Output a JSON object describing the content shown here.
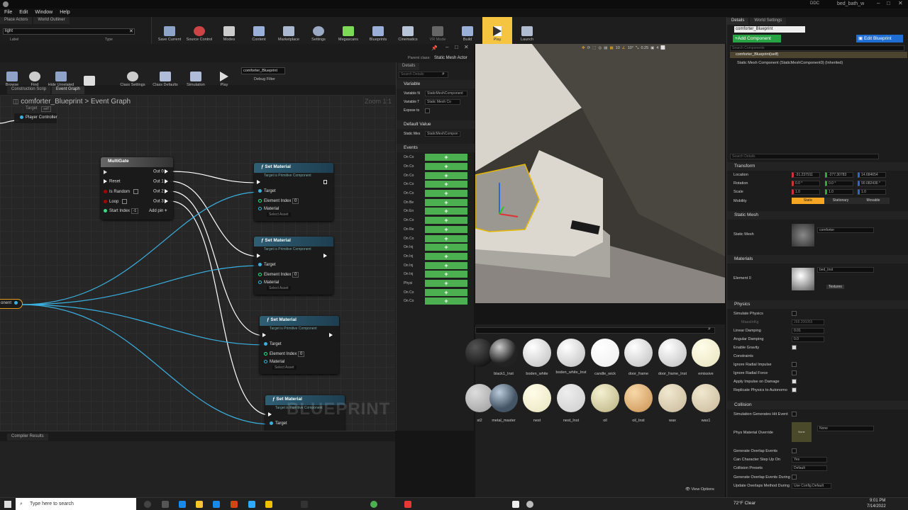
{
  "window": {
    "title": "bed_bath_w",
    "ddc": "DDC"
  },
  "menu": [
    "File",
    "Edit",
    "Window",
    "Help"
  ],
  "left_panel": {
    "tabs": [
      "Place Actors",
      "World Outliner"
    ],
    "search_value": "light",
    "col_label": "Label",
    "col_type": "Type"
  },
  "toolbar": [
    "Save Current",
    "Source Control",
    "Modes",
    "Content",
    "Marketplace",
    "Settings",
    "Megascans",
    "Blueprints",
    "Cinematics",
    "VR Mode",
    "Build",
    "Play",
    "Launch"
  ],
  "blueprint": {
    "parent_class_label": "Parent class:",
    "parent_class": "Static Mesh Actor",
    "toolbar": [
      "Browse",
      "Find",
      "Hide Unrelated",
      "Class Settings",
      "Class Defaults",
      "Simulation",
      "Play"
    ],
    "debug_object": "comforter_Blueprint",
    "debug_filter": "Debug Filter",
    "tabs": [
      "Construction Scrip",
      "Event Graph"
    ],
    "breadcrumb_root": "comforter_Blueprint",
    "breadcrumb_sep": ">",
    "breadcrumb_leaf": "Event Graph",
    "zoom": "Zoom 1:1",
    "watermark": "BLUEPRINT",
    "compiler_tab": "Compiler Results",
    "nodes": {
      "top_target": "Target",
      "top_self": "self",
      "player_controller": "Player Controller",
      "multigate": {
        "title": "MultiGate",
        "reset": "Reset",
        "is_random": "Is Random",
        "loop": "Loop",
        "start_index": "Start Index",
        "start_value": "-1",
        "outs": [
          "Out 0",
          "Out 1",
          "Out 2",
          "Out 3"
        ],
        "add_pin": "Add pin"
      },
      "set_material": {
        "title": "Set Material",
        "subtitle": "Target is Primitive Component",
        "target": "Target",
        "element_index": "Element Index",
        "material": "Material",
        "select_asset": "Select Asset"
      },
      "element_indices": [
        "0",
        "0",
        "0"
      ],
      "component": "onent"
    }
  },
  "bp_details": {
    "tab": "Details",
    "search_placeholder": "Search Details",
    "variable_section": "Variable",
    "variable_name_label": "Variable N",
    "variable_name": "StaticMeshComponent",
    "variable_type_label": "Variable T",
    "variable_type": "Static Mesh Co",
    "expose_label": "Expose to",
    "default_section": "Default Value",
    "static_mesh_label": "Static Mes",
    "static_mesh_value": "StaticMeshCompon",
    "events_section": "Events",
    "events": [
      "On Co",
      "On Co",
      "On Co",
      "On Co",
      "On Co",
      "On Be",
      "On En",
      "On Co",
      "On Re",
      "On Co",
      "On Inj",
      "On Inj",
      "On Inj",
      "On Inj",
      "Physi",
      "On Co",
      "On Co"
    ],
    "plus": "+"
  },
  "viewport": {
    "toolbar_values": [
      "10",
      "10°",
      "0.25",
      "4"
    ]
  },
  "content_browser": {
    "row1": [
      "black1_Inst",
      "boden_white",
      "boden_white_Inst",
      "candle_wick",
      "door_frame",
      "door_frame_Inst",
      "emissive"
    ],
    "row2": [
      "st2",
      "metal_master",
      "nest",
      "nest_Inst",
      "oil",
      "oil_Inst",
      "wax",
      "wax1"
    ],
    "view_options": "View Options"
  },
  "details": {
    "tabs": [
      "Details",
      "World Settings"
    ],
    "name": "comforter_Blueprint",
    "add_component": "+Add Component",
    "edit_blueprint": "Edit Blueprint",
    "search_components": "Search Components",
    "self_item": "comforter_Blueprint(self)",
    "smc_item": "Static Mesh Component (StaticMeshComponent0) (Inherited)",
    "search_details": "Search Details",
    "transform": {
      "title": "Transform",
      "location_label": "Location",
      "rotation_label": "Rotation",
      "scale_label": "Scale",
      "mobility_label": "Mobility",
      "location": [
        "-31.237911",
        "-277.30783",
        "14.684654"
      ],
      "rotation": [
        "0.0 °",
        "0.0 °",
        "90.082436 °"
      ],
      "scale": [
        "1.0",
        "1.0",
        "1.0"
      ],
      "mobility": [
        "Static",
        "Stationary",
        "Movable"
      ]
    },
    "static_mesh": {
      "title": "Static Mesh",
      "label": "Static Mesh",
      "value": "comforter"
    },
    "materials": {
      "title": "Materials",
      "element_label": "Element 0",
      "value": "bed_Inst",
      "textures": "Textures"
    },
    "physics": {
      "title": "Physics",
      "simulate": "Simulate Physics",
      "mass": "MassInKg",
      "mass_value": "268.206055",
      "linear": "Linear Damping",
      "linear_value": "0.01",
      "angular": "Angular Damping",
      "angular_value": "0.0",
      "gravity": "Enable Gravity",
      "constraints": "Constraints",
      "ignore_impulse": "Ignore Radial Impulse",
      "ignore_force": "Ignore Radial Force",
      "apply_impulse": "Apply Impulse on Damage",
      "replicate": "Replicate Physics to Autonomo"
    },
    "collision": {
      "title": "Collision",
      "sim_hit": "Simulation Generates Hit Event",
      "phys_mat": "Phys Material Override",
      "phys_none": "None",
      "phys_value": "None",
      "overlap": "Generate Overlap Events",
      "step_up": "Can Character Step Up On",
      "step_up_value": "Yes",
      "presets": "Collision Presets",
      "presets_value": "Default",
      "overlap_during": "Generate Overlap Events During",
      "update_overlap": "Update Overlaps Method During",
      "update_value": "Use Config Default"
    }
  },
  "taskbar": {
    "search": "Type here to search",
    "weather": "72°F  Clear",
    "time": "9:01 PM",
    "date": "7/14/2022"
  },
  "colors": {
    "accent_blue": "#3ab0e0",
    "event_green": "#4caf50",
    "select_yellow": "#e6b800",
    "static_orange": "#f5a623"
  }
}
